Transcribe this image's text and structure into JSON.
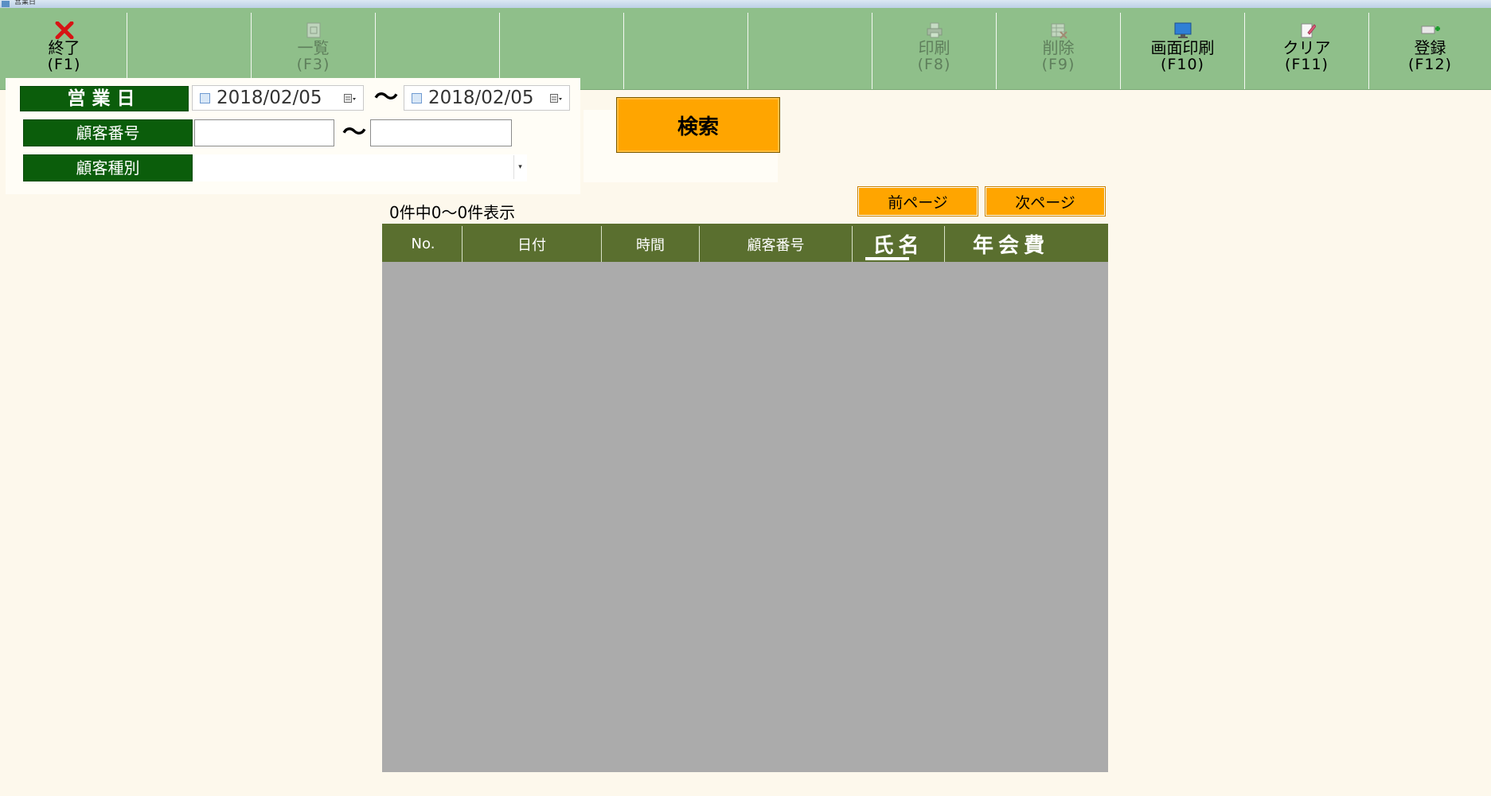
{
  "window": {
    "title": "営業日"
  },
  "toolbar": {
    "buttons": [
      {
        "label": "終了",
        "key": "(F1)",
        "icon": "close-x-icon",
        "enabled": true
      },
      {
        "label": "",
        "key": "",
        "icon": "",
        "enabled": false
      },
      {
        "label": "一覧",
        "key": "(F3)",
        "icon": "list-icon",
        "enabled": false
      },
      {
        "label": "",
        "key": "",
        "icon": "",
        "enabled": false
      },
      {
        "label": "",
        "key": "",
        "icon": "",
        "enabled": false
      },
      {
        "label": "",
        "key": "",
        "icon": "",
        "enabled": false
      },
      {
        "label": "",
        "key": "",
        "icon": "",
        "enabled": false
      },
      {
        "label": "印刷",
        "key": "(F8)",
        "icon": "printer-icon",
        "enabled": false
      },
      {
        "label": "削除",
        "key": "(F9)",
        "icon": "delete-table-icon",
        "enabled": false
      },
      {
        "label": "画面印刷",
        "key": "(F10)",
        "icon": "monitor-icon",
        "enabled": true
      },
      {
        "label": "クリア",
        "key": "(F11)",
        "icon": "eraser-icon",
        "enabled": true
      },
      {
        "label": "登録",
        "key": "(F12)",
        "icon": "add-record-icon",
        "enabled": true
      }
    ]
  },
  "criteria": {
    "business_date_label": "営業日",
    "date_from": "2018/02/05",
    "date_to": "2018/02/05",
    "customer_no_label": "顧客番号",
    "customer_no_from": "",
    "customer_no_to": "",
    "customer_type_label": "顧客種別",
    "customer_type_value": "",
    "range_separator": "〜"
  },
  "search_label": "検索",
  "result_count": "0件中0〜0件表示",
  "pager": {
    "prev": "前ページ",
    "next": "次ページ"
  },
  "grid": {
    "columns": [
      "No.",
      "日付",
      "時間",
      "顧客番号",
      "氏名",
      "年会費"
    ],
    "rows": []
  },
  "colors": {
    "toolbar_bg": "#8fbf8a",
    "label_bg": "#0b5d0b",
    "accent_button": "#ffa500",
    "grid_header": "#5a6f2f",
    "grid_body": "#ababab",
    "page_bg": "#fdf8ec"
  }
}
